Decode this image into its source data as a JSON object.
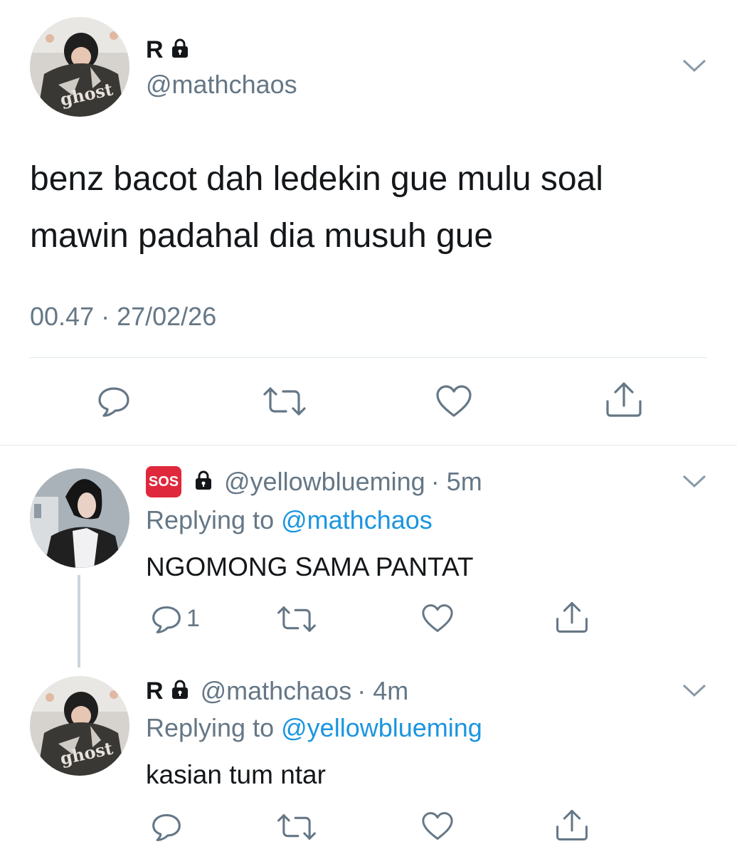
{
  "main_tweet": {
    "display_name": "R",
    "handle": "@mathchaos",
    "text_line1": "benz bacot dah ledekin gue mulu soal",
    "text_line2": "mawin padahal dia musuh gue",
    "timestamp": "00.47 · 27/02/26",
    "avatar_text": "ghost"
  },
  "reply1": {
    "badge": "SOS",
    "handle": "@yellowblueming",
    "time": "· 5m",
    "replying_prefix": "Replying to",
    "replying_to": "@mathchaos",
    "text": "NGOMONG SAMA PANTAT",
    "reply_count": "1"
  },
  "reply2": {
    "display_name": "R",
    "handle": "@mathchaos",
    "time": "· 4m",
    "replying_prefix": "Replying to",
    "replying_to": "@yellowblueming",
    "text": "kasian tum ntar",
    "avatar_text": "ghost"
  },
  "colors": {
    "text": "#14171a",
    "secondary": "#657786",
    "link": "#1b95e0",
    "divider": "#e1e8ed",
    "sos": "#e0283c"
  }
}
